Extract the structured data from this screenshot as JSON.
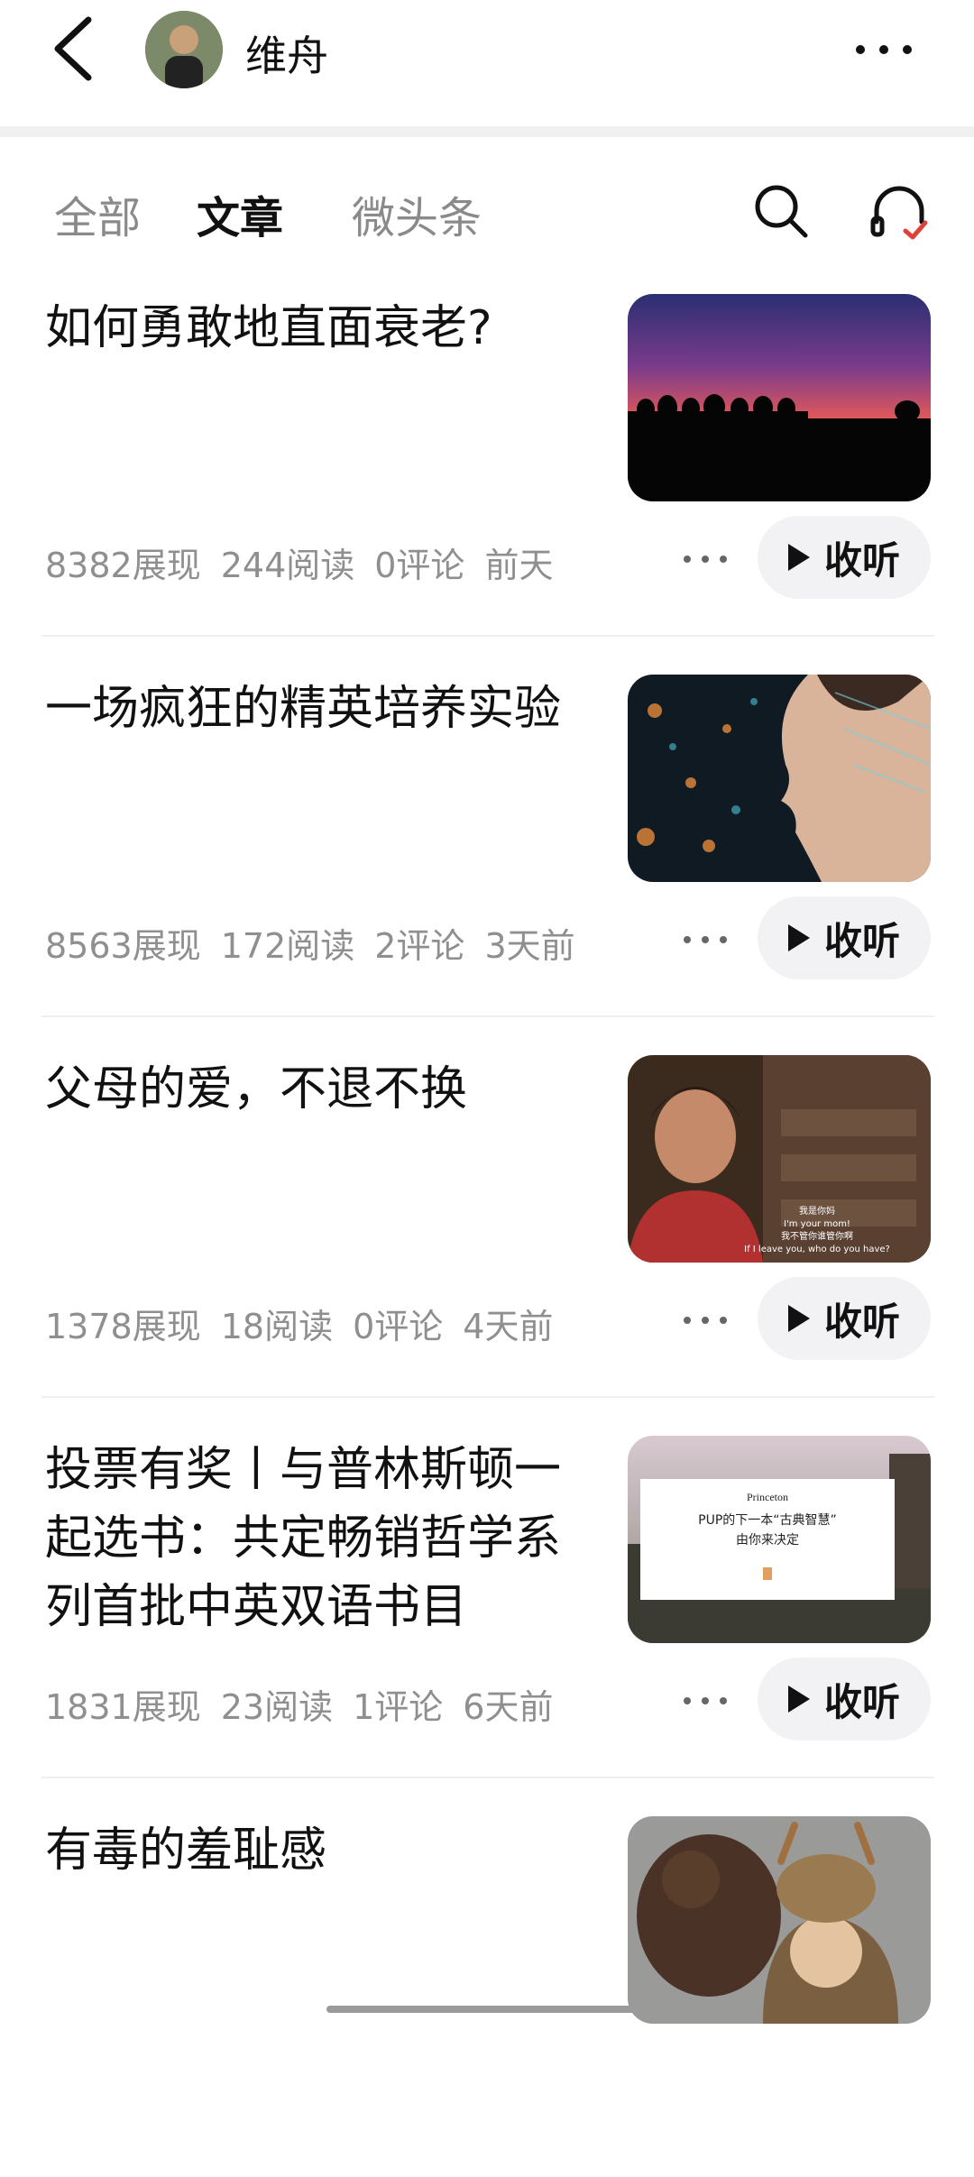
{
  "header": {
    "author": "维舟"
  },
  "tabs": [
    {
      "label": "全部"
    },
    {
      "label": "文章"
    },
    {
      "label": "微头条"
    }
  ],
  "articles": [
    {
      "title": "如何勇敢地直面衰老?",
      "views": "8382展现",
      "reads": "244阅读",
      "comments": "0评论",
      "time": "前天",
      "listen": "收听",
      "thumb": "sunset-landscape"
    },
    {
      "title": "一场疯狂的精英培养实验",
      "views": "8563展现",
      "reads": "172阅读",
      "comments": "2评论",
      "time": "3天前",
      "listen": "收听",
      "thumb": "digital-face"
    },
    {
      "title": "父母的爱，不退不换",
      "views": "1378展现",
      "reads": "18阅读",
      "comments": "0评论",
      "time": "4天前",
      "listen": "收听",
      "thumb": "film-still",
      "thumb_caption": [
        "我是你妈",
        "I'm your mom!",
        "我不管你谁管你啊",
        "If I leave you, who do you have?"
      ]
    },
    {
      "title": "投票有奖丨与普林斯顿一起选书：共定畅销哲学系列首批中英双语书目",
      "views": "1831展现",
      "reads": "23阅读",
      "comments": "1评论",
      "time": "6天前",
      "listen": "收听",
      "thumb": "princeton-card",
      "thumb_card": {
        "brand": "Princeton",
        "line1": "PUP的下一本“古典智慧”",
        "line2": "由你来决定"
      }
    },
    {
      "title": "有毒的羞耻感",
      "thumb": "bear-costume"
    }
  ],
  "colors": {
    "accent_check": "#e0403a",
    "muted": "#8f8f8f",
    "pill_bg": "#f2f2f4"
  },
  "icons": [
    "back-arrow-icon",
    "more-icon",
    "search-icon",
    "headphones-icon",
    "play-icon"
  ]
}
